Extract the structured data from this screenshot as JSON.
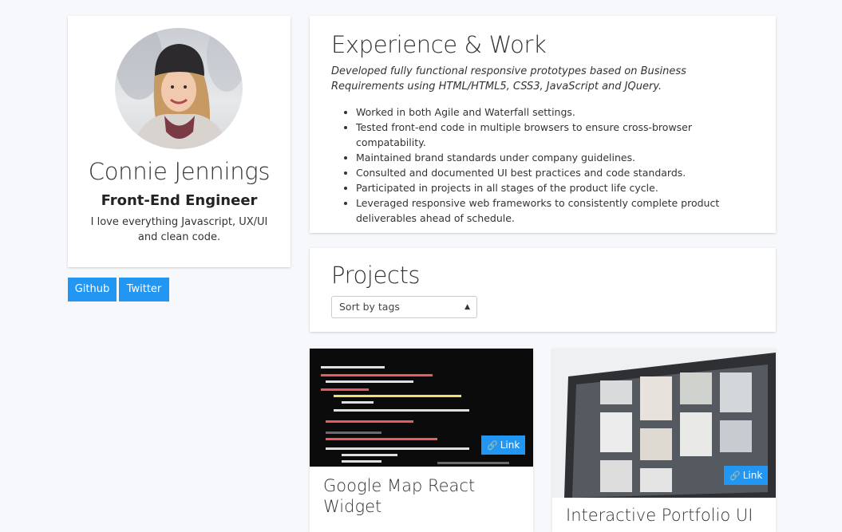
{
  "profile": {
    "name": "Connie Jennings",
    "role": "Front-End Engineer",
    "bio": "I love everything Javascript, UX/UI and clean code."
  },
  "social": {
    "github_label": "Github",
    "twitter_label": "Twitter"
  },
  "experience": {
    "title": "Experience & Work",
    "description": "Developed fully functional responsive prototypes based on Business Requirements using HTML/HTML5, CSS3, JavaScript and JQuery.",
    "items": [
      "Worked in both Agile and Waterfall settings.",
      "Tested front-end code in multiple browsers to ensure cross-browser compatability.",
      "Maintained brand standards under company guidelines.",
      "Consulted and documented UI best practices and code standards.",
      "Participated in projects in all stages of the product life cycle.",
      "Leveraged responsive web frameworks to consistently complete product deliverables ahead of schedule."
    ]
  },
  "projects": {
    "title": "Projects",
    "sort_value": "Sort by tags",
    "cards": [
      {
        "title": "Google Map React Widget",
        "link_label": "Link"
      },
      {
        "title": "Interactive Portfolio UI",
        "link_label": "Link"
      }
    ]
  },
  "colors": {
    "accent": "#2196f3",
    "background": "#f6f8fc"
  }
}
